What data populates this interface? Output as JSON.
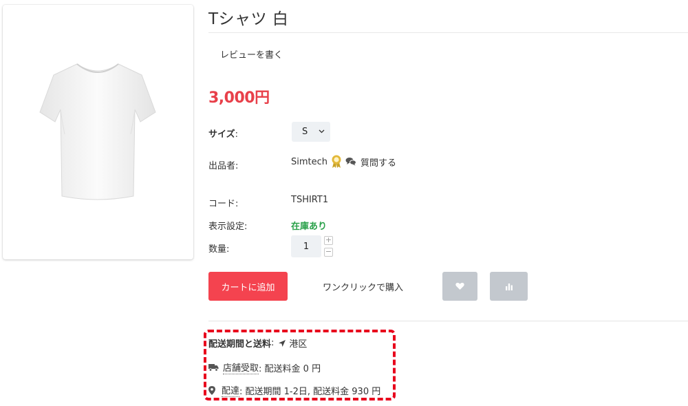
{
  "product": {
    "title": "Tシャツ 白",
    "review_link": "レビューを書く",
    "price": "3,000",
    "currency": "円"
  },
  "options": {
    "size_label": "サイズ",
    "size_colon": ":",
    "size_value": "S"
  },
  "vendor": {
    "label": "出品者:",
    "name": "Simtech",
    "ask_label": "質問する"
  },
  "details": {
    "code_label": "コード:",
    "code_value": "TSHIRT1",
    "availability_label": "表示設定:",
    "availability_value": "在庫あり",
    "quantity_label": "数量:",
    "quantity_value": "1",
    "increment_symbol": "+",
    "decrement_symbol": "−"
  },
  "actions": {
    "add_to_cart": "カートに追加",
    "one_click": "ワンクリックで購入",
    "wishlist_icon": "heart-icon",
    "compare_icon": "bar-chart-icon"
  },
  "shipping": {
    "heading": "配送期間と送料",
    "heading_colon": ":",
    "location": "港区",
    "pickup_name": "店舗受取",
    "pickup_detail": ": 配送料金 0 円",
    "delivery_name": "配達",
    "delivery_detail": ": 配送期間 1-2日, 配送料金 930 円"
  },
  "colors": {
    "accent": "#f4434f",
    "price": "#e8404a",
    "in_stock": "#2aa14a",
    "highlight": "#e8001c"
  }
}
